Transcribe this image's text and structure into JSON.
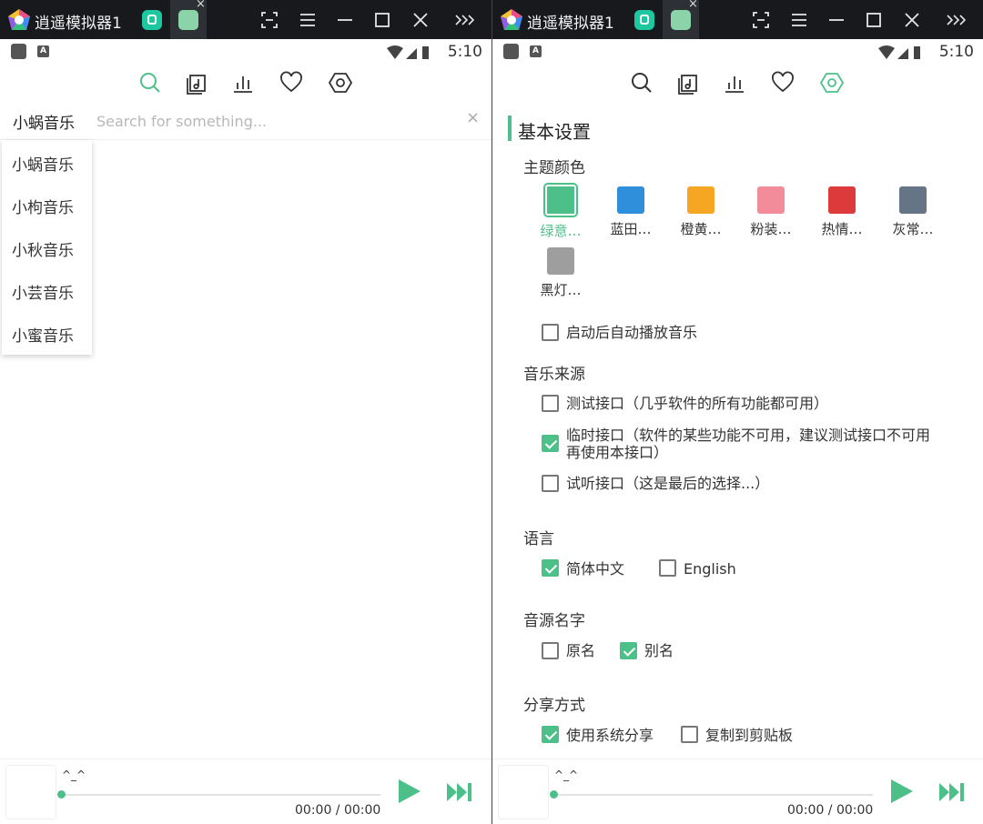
{
  "emulator": {
    "title": "逍遥模拟器1"
  },
  "status_bar": {
    "time": "5:10"
  },
  "left": {
    "search": {
      "source": "小蜗音乐",
      "placeholder": "Search for something...",
      "clear_icon": "×"
    },
    "dropdown": [
      "小蜗音乐",
      "小枸音乐",
      "小秋音乐",
      "小芸音乐",
      "小蜜音乐"
    ]
  },
  "player": {
    "title": "^_^",
    "time": "00:00 / 00:00",
    "progress": 0
  },
  "settings": {
    "section_title": "基本设置",
    "theme": {
      "label": "主题颜色",
      "swatches": [
        {
          "label": "绿意…",
          "color": "#4dc08a",
          "active": true
        },
        {
          "label": "蓝田…",
          "color": "#2f8fdb",
          "active": false
        },
        {
          "label": "橙黄…",
          "color": "#f5a623",
          "active": false
        },
        {
          "label": "粉装…",
          "color": "#f28b9a",
          "active": false
        },
        {
          "label": "热情…",
          "color": "#dd3b3b",
          "active": false
        },
        {
          "label": "灰常…",
          "color": "#657586",
          "active": false
        },
        {
          "label": "黑灯…",
          "color": "#9e9e9e",
          "active": false
        }
      ]
    },
    "autoplay": {
      "label": "启动后自动播放音乐",
      "checked": false
    },
    "source": {
      "label": "音乐来源",
      "options": [
        {
          "label": "测试接口（几乎软件的所有功能都可用）",
          "checked": false
        },
        {
          "label": "临时接口（软件的某些功能不可用，建议测试接口不可用",
          "label2": "再使用本接口）",
          "checked": true
        },
        {
          "label": "试听接口（这是最后的选择...）",
          "checked": false
        }
      ]
    },
    "language": {
      "label": "语言",
      "options": [
        {
          "label": "简体中文",
          "checked": true
        },
        {
          "label": "English",
          "checked": false
        }
      ]
    },
    "source_name": {
      "label": "音源名字",
      "options": [
        {
          "label": "原名",
          "checked": false
        },
        {
          "label": "别名",
          "checked": true
        }
      ]
    },
    "share": {
      "label": "分享方式",
      "options": [
        {
          "label": "使用系统分享",
          "checked": true
        },
        {
          "label": "复制到剪贴板",
          "checked": false
        }
      ]
    }
  },
  "colors": {
    "accent": "#4dc08a",
    "titlebar": "#17191c"
  }
}
